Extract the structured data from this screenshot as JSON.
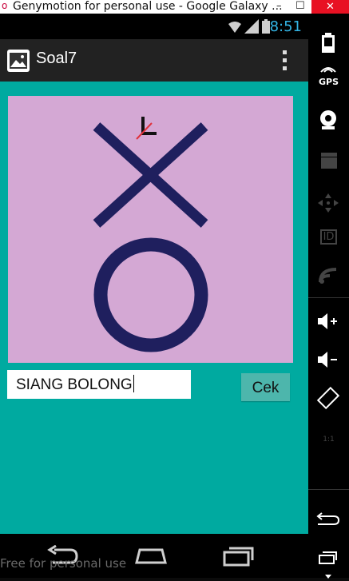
{
  "window": {
    "title": "Genymotion for personal use - Google Galaxy ...",
    "minimize": "–",
    "maximize": "☐",
    "close": "✕"
  },
  "statusbar": {
    "time": "8:51"
  },
  "actionbar": {
    "title": "Soal7"
  },
  "puzzle": {
    "symbols": [
      "X",
      "O",
      "clock-icon"
    ],
    "colors": {
      "symbol": "#1f1f5e",
      "background": "#d4a8d4",
      "clock_hand": "#e0323c"
    }
  },
  "form": {
    "answer_value": "SIANG BOLONG",
    "check_label": "Cek"
  },
  "navbar": {
    "watermark": "Free for personal use"
  },
  "sidepanel": {
    "gps_label": "GPS",
    "id_label": "ID",
    "ratio_label": "1:1"
  },
  "colors": {
    "content_bg": "#00aaa0",
    "actionbar_bg": "#222222",
    "button_bg": "#4db6ac",
    "clock_text": "#33b5e5"
  }
}
